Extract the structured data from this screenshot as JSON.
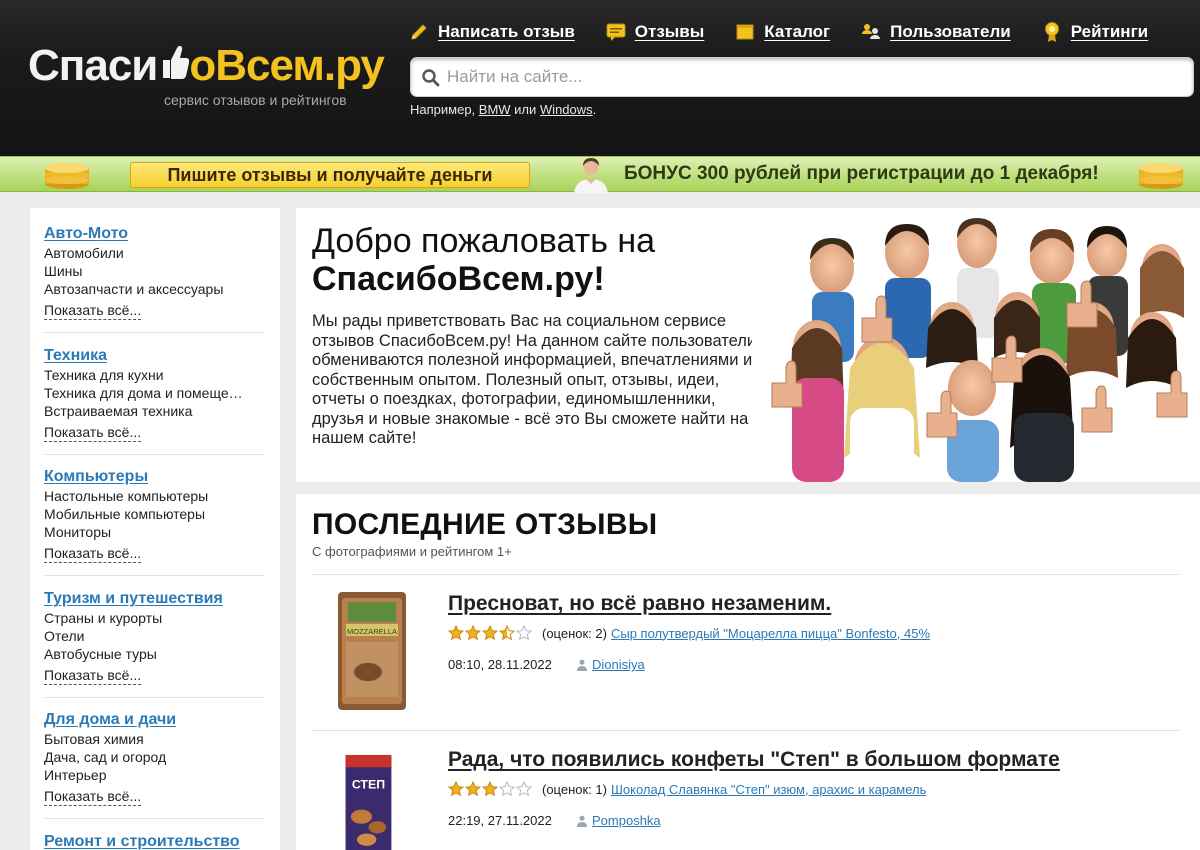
{
  "header": {
    "logo_part1": "Спаси",
    "logo_part2": "оВсем.ру",
    "logo_tagline": "сервис отзывов и рейтингов",
    "nav": [
      {
        "label": "Написать отзыв",
        "icon": "pencil-icon"
      },
      {
        "label": "Отзывы",
        "icon": "speech-bubble-icon"
      },
      {
        "label": "Каталог",
        "icon": "catalog-icon"
      },
      {
        "label": "Пользователи",
        "icon": "users-icon"
      },
      {
        "label": "Рейтинги",
        "icon": "medal-icon"
      }
    ],
    "search_placeholder": "Найти на сайте...",
    "hint_prefix": "Например, ",
    "hint_link1": "BMW",
    "hint_mid": " или ",
    "hint_link2": "Windows",
    "hint_suffix": "."
  },
  "banner": {
    "left_text": "Пишите отзывы и получайте деньги",
    "right_text": "БОНУС 300 рублей при регистрации до 1 декабря!"
  },
  "sidebar": {
    "more_label": "Показать всё...",
    "categories": [
      {
        "title": "Авто-Мото",
        "items": [
          "Автомобили",
          "Шины",
          "Автозапчасти и аксессуары"
        ]
      },
      {
        "title": "Техника",
        "items": [
          "Техника для кухни",
          "Техника для дома и помещений",
          "Встраиваемая техника"
        ]
      },
      {
        "title": "Компьютеры",
        "items": [
          "Настольные компьютеры",
          "Мобильные компьютеры",
          "Мониторы"
        ]
      },
      {
        "title": "Туризм и путешествия",
        "items": [
          "Страны и курорты",
          "Отели",
          "Автобусные туры"
        ]
      },
      {
        "title": "Для дома и дачи",
        "items": [
          "Бытовая химия",
          "Дача, сад и огород",
          "Интерьер"
        ]
      },
      {
        "title": "Ремонт и строительство",
        "items": []
      }
    ]
  },
  "welcome": {
    "title_line1": "Добро пожаловать на",
    "title_line2": "СпасибоВсем.ру!",
    "text": "Мы рады приветствовать Вас на социальном сервисе отзывов СпасибоВсем.ру! На данном сайте пользователи обмениваются полезной информацией, впечатлениями и собственным опытом. Полезный опыт, отзывы, идеи, отчеты о поездках, фотографии, единомышленники, друзья и новые знакомые - всё это Вы сможете найти на нашем сайте!"
  },
  "reviews": {
    "title": "ПОСЛЕДНИЕ ОТЗЫВЫ",
    "subtitle": "С фотографиями и рейтингом 1+",
    "items": [
      {
        "headline": "Пресноват, но всё равно незаменим.",
        "rating": 3.5,
        "count_text": "(оценок: 2)",
        "product": "Сыр полутвердый \"Моцарелла пицца\" Bonfesto, 45%",
        "date": "08:10, 28.11.2022",
        "user": "Dionisiya",
        "thumb_label": "MOZZARELLA"
      },
      {
        "headline": "Рада, что появились конфеты \"Степ\" в большом формате",
        "rating": 3,
        "count_text": "(оценок: 1)",
        "product": "Шоколад Славянка \"Степ\" изюм, арахис и карамель",
        "date": "22:19, 27.11.2022",
        "user": "Pomposhka",
        "thumb_label": "СТЕП"
      }
    ]
  },
  "colors": {
    "accent_yellow": "#f4c21f",
    "link_blue": "#2a7ab8",
    "banner_green": "#bfe07e",
    "header_dark": "#1a1a1a"
  }
}
